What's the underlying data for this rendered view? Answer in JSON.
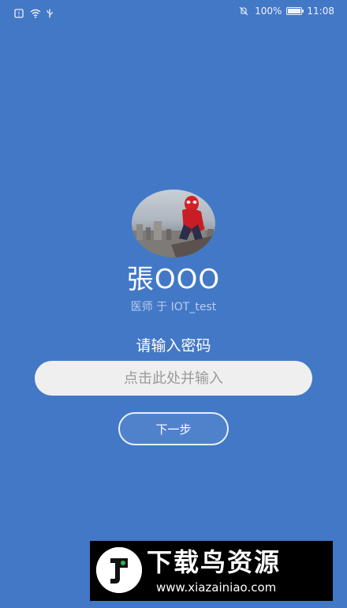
{
  "status_bar": {
    "left_icons": [
      "sim-icon",
      "wifi-icon",
      "usb-icon"
    ],
    "right_icons": [
      "mute-icon",
      "battery-icon"
    ],
    "battery_percent": "100%",
    "battery_level": 1.0,
    "time": "11:08"
  },
  "profile": {
    "avatar": "avatar-image",
    "name": "張OOO",
    "role": "医师 于 IOT_test"
  },
  "login": {
    "prompt": "请输入密码",
    "password_placeholder": "点击此处并输入",
    "next_button": "下一步"
  },
  "watermark": {
    "title": "下载鸟资源",
    "url": "www.xiazainiao.com"
  },
  "colors": {
    "background": "#4378C6",
    "role_text": "#B9CDEF",
    "input_bg": "#EFEFEF",
    "button_bg": "#4F82CB"
  }
}
